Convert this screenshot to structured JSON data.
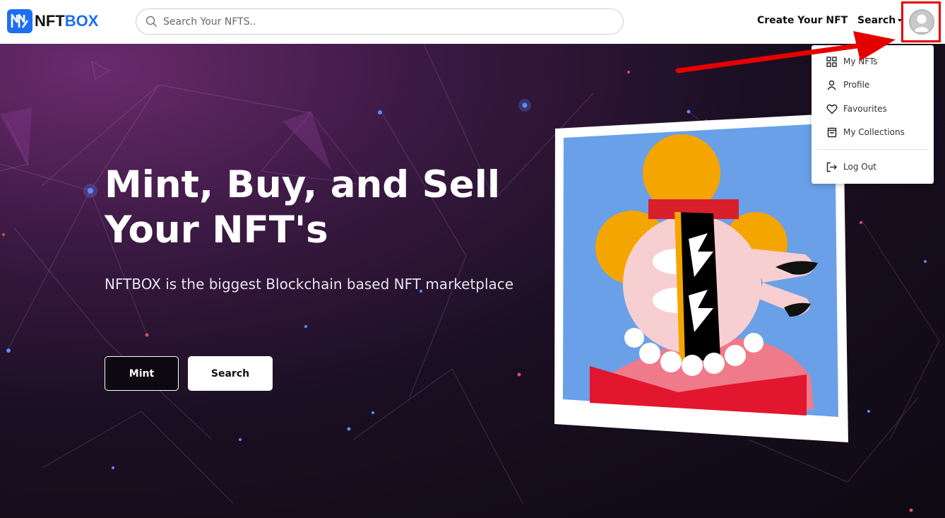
{
  "brand": {
    "name_part1": "NFT",
    "name_part2": "BOX",
    "color": "#1d6ff2"
  },
  "search": {
    "placeholder": "Search Your NFTS.."
  },
  "nav": {
    "create_label": "Create Your NFT",
    "search_label": "Search"
  },
  "hero": {
    "title_line1": "Mint, Buy, and Sell",
    "title_line2": "Your NFT's",
    "subtitle": "NFTBOX is the biggest Blockchain based NFT marketplace",
    "mint_label": "Mint",
    "search_label": "Search"
  },
  "dropdown": {
    "items": [
      {
        "label": "My NFTs",
        "icon": "grid-icon"
      },
      {
        "label": "Profile",
        "icon": "user-icon"
      },
      {
        "label": "Favourites",
        "icon": "heart-icon"
      },
      {
        "label": "My Collections",
        "icon": "bag-icon"
      },
      {
        "label": "Log Out",
        "icon": "logout-icon"
      }
    ]
  },
  "colors": {
    "highlight": "#e50000",
    "accent": "#1d6ff2"
  }
}
